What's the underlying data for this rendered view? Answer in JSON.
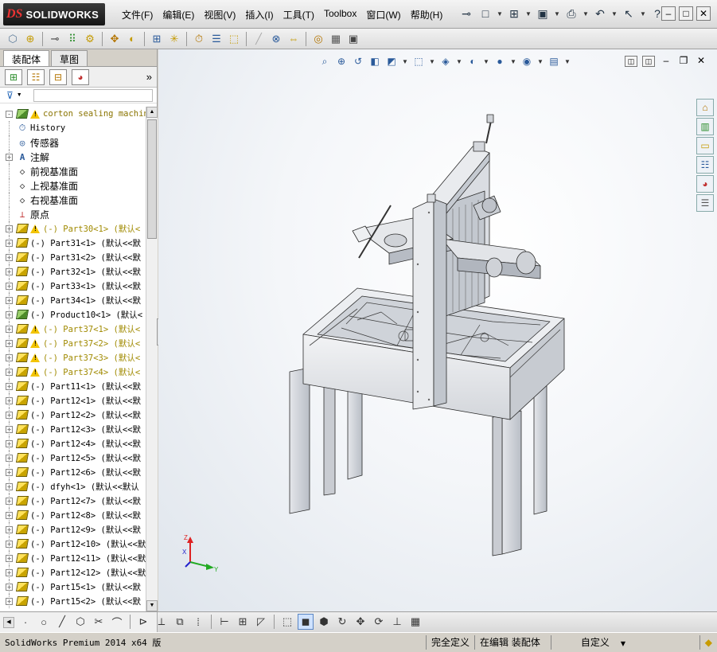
{
  "app": {
    "logo_ds": "DS",
    "logo_name": "SOLIDWORKS"
  },
  "menu": [
    "文件(F)",
    "编辑(E)",
    "视图(V)",
    "插入(I)",
    "工具(T)",
    "Toolbox",
    "窗口(W)",
    "帮助(H)"
  ],
  "title_tools": [
    {
      "icon": "pushpin-icon",
      "glyph": "⊸"
    },
    {
      "icon": "new-document-icon",
      "glyph": "□",
      "dropdown": true
    },
    {
      "icon": "open-folder-icon",
      "glyph": "⊞",
      "dropdown": true
    },
    {
      "icon": "save-icon",
      "glyph": "▣",
      "dropdown": true
    },
    {
      "icon": "print-icon",
      "glyph": "⎙",
      "dropdown": true
    },
    {
      "icon": "undo-icon",
      "glyph": "↶",
      "dropdown": true
    },
    {
      "icon": "select-icon",
      "glyph": "↖",
      "dropdown": true
    },
    {
      "icon": "help-icon",
      "glyph": "?",
      "dropdown": true
    }
  ],
  "window_buttons": [
    {
      "name": "minimize",
      "glyph": "–"
    },
    {
      "name": "restore",
      "glyph": "□"
    },
    {
      "name": "close",
      "glyph": "✕"
    }
  ],
  "command_toolbar": [
    "edit-component-icon",
    "insert-components-icon",
    "mate-icon",
    "component-pattern-icon",
    "smart-fasteners-icon",
    "move-component-icon",
    "show-hidden-icon",
    "assembly-features-icon",
    "reference-geometry-icon",
    "new-motion-study-icon",
    "bill-of-materials-icon",
    "exploded-view-icon",
    "explode-line-sketch-icon",
    "interference-detection-icon",
    "clearance-verification-icon",
    "hole-alignment-icon",
    "measure-icon",
    "mass-properties-icon"
  ],
  "panel_tabs": [
    {
      "label": "装配体",
      "active": true
    },
    {
      "label": "草图",
      "active": false
    }
  ],
  "panel_icons": [
    "featuremanager-icon",
    "propertymanager-icon",
    "configurationmanager-icon",
    "displaymanager-icon"
  ],
  "tree": [
    {
      "label": "corton sealing machine",
      "type": "root",
      "warn": true,
      "expand": "-",
      "style": "root"
    },
    {
      "label": "History",
      "type": "history",
      "expand": ""
    },
    {
      "label": "传感器",
      "type": "sensor",
      "expand": "",
      "cn": true
    },
    {
      "label": "注解",
      "type": "annotation",
      "expand": "+",
      "cn": true
    },
    {
      "label": "前视基准面",
      "type": "plane",
      "expand": "",
      "cn": true
    },
    {
      "label": "上视基准面",
      "type": "plane",
      "expand": "",
      "cn": true
    },
    {
      "label": "右视基准面",
      "type": "plane",
      "expand": "",
      "cn": true
    },
    {
      "label": "原点",
      "type": "origin",
      "expand": "",
      "cn": true
    },
    {
      "label": "(-) Part30<1> (默认<",
      "type": "part",
      "warn": true,
      "expand": "+",
      "style": "warnc"
    },
    {
      "label": "(-) Part31<1> (默认<<默",
      "type": "part",
      "expand": "+"
    },
    {
      "label": "(-) Part31<2> (默认<<默",
      "type": "part",
      "expand": "+"
    },
    {
      "label": "(-) Part32<1> (默认<<默",
      "type": "part",
      "expand": "+"
    },
    {
      "label": "(-) Part33<1> (默认<<默",
      "type": "part",
      "expand": "+"
    },
    {
      "label": "(-) Part34<1> (默认<<默",
      "type": "part",
      "expand": "+"
    },
    {
      "label": "(-) Product10<1> (默认<",
      "type": "assembly",
      "expand": "+"
    },
    {
      "label": "(-) Part37<1> (默认<",
      "type": "part",
      "warn": true,
      "expand": "+",
      "style": "warnc"
    },
    {
      "label": "(-) Part37<2> (默认<",
      "type": "part",
      "warn": true,
      "expand": "+",
      "style": "warnc"
    },
    {
      "label": "(-) Part37<3> (默认<",
      "type": "part",
      "warn": true,
      "expand": "+",
      "style": "warnc"
    },
    {
      "label": "(-) Part37<4> (默认<",
      "type": "part",
      "warn": true,
      "expand": "+",
      "style": "warnc"
    },
    {
      "label": "(-) Part11<1> (默认<<默",
      "type": "part",
      "expand": "+"
    },
    {
      "label": "(-) Part12<1> (默认<<默",
      "type": "part",
      "expand": "+"
    },
    {
      "label": "(-) Part12<2> (默认<<默",
      "type": "part",
      "expand": "+"
    },
    {
      "label": "(-) Part12<3> (默认<<默",
      "type": "part",
      "expand": "+"
    },
    {
      "label": "(-) Part12<4> (默认<<默",
      "type": "part",
      "expand": "+"
    },
    {
      "label": "(-) Part12<5> (默认<<默",
      "type": "part",
      "expand": "+"
    },
    {
      "label": "(-) Part12<6> (默认<<默",
      "type": "part",
      "expand": "+"
    },
    {
      "label": "(-) dfyh<1> (默认<<默认",
      "type": "part",
      "expand": "+"
    },
    {
      "label": "(-) Part12<7> (默认<<默",
      "type": "part",
      "expand": "+"
    },
    {
      "label": "(-) Part12<8> (默认<<默",
      "type": "part",
      "expand": "+"
    },
    {
      "label": "(-) Part12<9> (默认<<默",
      "type": "part",
      "expand": "+"
    },
    {
      "label": "(-) Part12<10> (默认<<默",
      "type": "part",
      "expand": "+"
    },
    {
      "label": "(-) Part12<11> (默认<<默",
      "type": "part",
      "expand": "+"
    },
    {
      "label": "(-) Part12<12> (默认<<默",
      "type": "part",
      "expand": "+"
    },
    {
      "label": "(-) Part15<1> (默认<<默",
      "type": "part",
      "expand": "+"
    },
    {
      "label": "(-) Part15<2> (默认<<默",
      "type": "part",
      "expand": "+"
    }
  ],
  "headsup_toolbar": [
    "zoom-to-fit-icon",
    "zoom-to-area-icon",
    "previous-view-icon",
    "section-view-icon",
    "dynamic-annotation-views-icon",
    "view-orientation-icon",
    "display-style-icon",
    "hide-show-items-icon",
    "edit-appearance-icon",
    "apply-scene-icon",
    "view-settings-icon"
  ],
  "task_pane": [
    "solidworks-resources-icon",
    "design-library-icon",
    "file-explorer-icon",
    "view-palette-icon",
    "appearances-icon",
    "custom-properties-icon"
  ],
  "triad": {
    "x": "X",
    "y": "Y",
    "z": "Z"
  },
  "bottom_toolbar": [
    "point-icon",
    "circle-icon",
    "line-icon",
    "polygon-icon",
    "trim-icon",
    "arc-icon",
    "convert-entities-icon",
    "mirror-icon",
    "offset-icon",
    "linear-pattern-icon",
    "dimension-icon",
    "grid-icon",
    "section-icon",
    "wireframe-icon",
    "shaded-icon",
    "shaded-with-edges-icon",
    "rebuild-icon",
    "move-entity-icon",
    "rotate-entity-icon",
    "sketch-relations-icon",
    "table-icon"
  ],
  "status": {
    "main": "SolidWorks Premium 2014 x64 版",
    "definition": "完全定义",
    "mode": "在编辑 装配体",
    "units": "自定义"
  }
}
